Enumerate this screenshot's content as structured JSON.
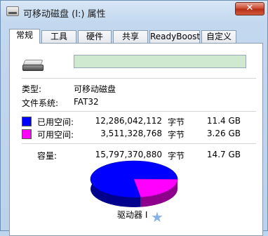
{
  "window": {
    "title": "可移动磁盘 (I:) 属性",
    "close_label": "✕"
  },
  "tabs": [
    {
      "label": "常规",
      "active": true
    },
    {
      "label": "工具",
      "active": false
    },
    {
      "label": "硬件",
      "active": false
    },
    {
      "label": "共享",
      "active": false
    },
    {
      "label": "ReadyBoost",
      "active": false
    },
    {
      "label": "自定义",
      "active": false
    }
  ],
  "general": {
    "drive_name_value": "",
    "type_label": "类型:",
    "type_value": "可移动磁盘",
    "fs_label": "文件系统:",
    "fs_value": "FAT32",
    "used": {
      "label": "已用空间:",
      "bytes": "12,286,042,112",
      "unit": "字节",
      "size": "11.4 GB",
      "color": "#0000ff"
    },
    "free": {
      "label": "可用空间:",
      "bytes": "3,511,328,768",
      "unit": "字节",
      "size": "3.26 GB",
      "color": "#ff00ff"
    },
    "capacity": {
      "label": "容量:",
      "bytes": "15,797,370,880",
      "unit": "字节",
      "size": "14.7 GB"
    },
    "drive_caption": "驱动器 I"
  },
  "chart_data": {
    "type": "pie",
    "categories": [
      "已用空间",
      "可用空间"
    ],
    "values": [
      12286042112,
      3511328768
    ],
    "colors": [
      "#0000ff",
      "#ff00ff"
    ]
  }
}
